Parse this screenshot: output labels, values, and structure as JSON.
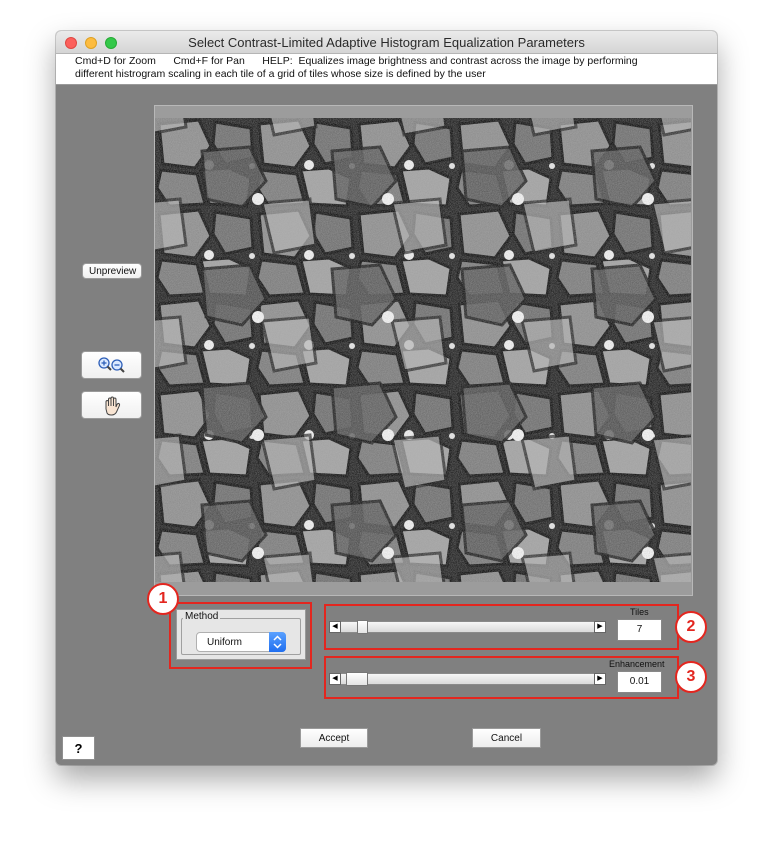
{
  "window": {
    "title": "Select Contrast-Limited Adaptive Histogram Equalization Parameters"
  },
  "help": {
    "line1": "Cmd+D for Zoom      Cmd+F for Pan      HELP:  Equalizes image brightness and contrast across the image by performing",
    "line2": "different histrogram scaling in each tile of a grid of tiles whose size is defined by the user"
  },
  "controls": {
    "unpreview_label": "Unpreview",
    "method": {
      "title": "Method",
      "selected": "Uniform"
    },
    "tiles": {
      "label": "Tiles",
      "value": "7",
      "slider_position": 0.1
    },
    "enhancement": {
      "label": "Enhancement",
      "value": "0.01",
      "slider_position": 0.06
    },
    "accept_label": "Accept",
    "cancel_label": "Cancel",
    "help_label": "?"
  },
  "callouts": [
    "1",
    "2",
    "3"
  ],
  "colors": {
    "window_background": "#808080",
    "callout_red": "#e3261f",
    "select_accent": "#2d7ff9"
  },
  "icons": {
    "zoom": "zoom-in-out-icon",
    "pan": "hand-pan-icon"
  }
}
